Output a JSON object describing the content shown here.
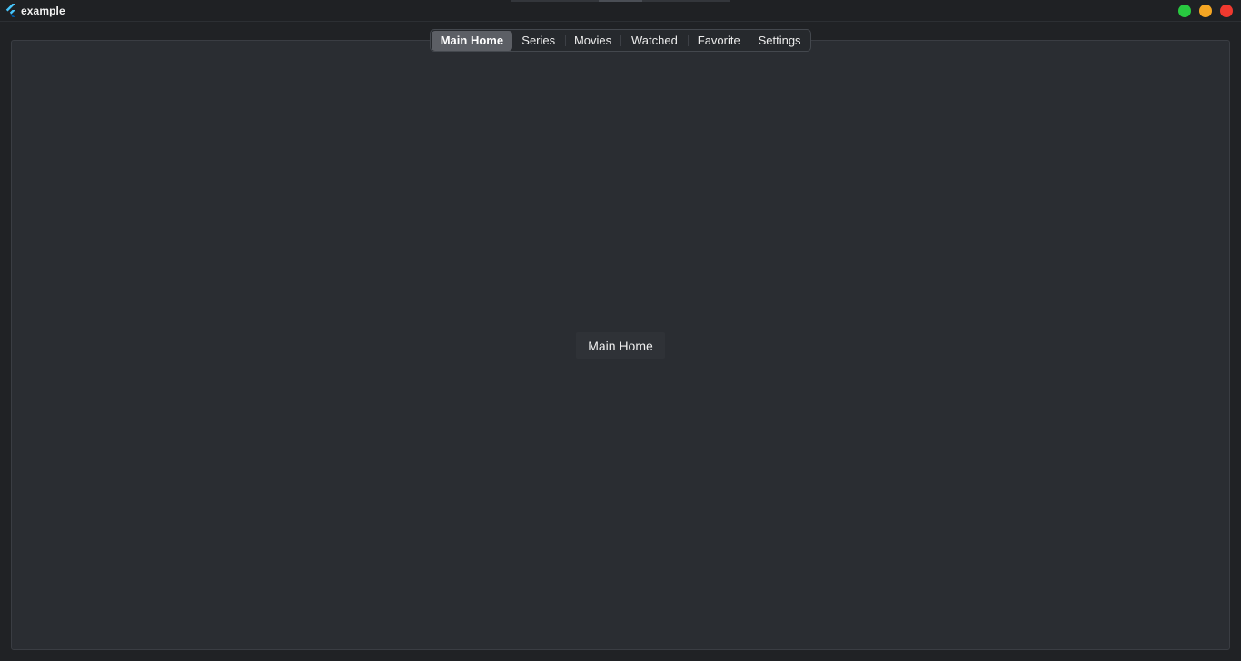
{
  "window": {
    "title": "example",
    "logo_icon": "flutter-logo-icon",
    "controls": [
      {
        "name": "maximize",
        "color": "#28c940"
      },
      {
        "name": "minimize",
        "color": "#f5a623"
      },
      {
        "name": "close",
        "color": "#f0392f"
      }
    ]
  },
  "tabs": [
    {
      "label": "Main Home",
      "active": true
    },
    {
      "label": "Series",
      "active": false
    },
    {
      "label": "Movies",
      "active": false
    },
    {
      "label": "Watched",
      "active": false
    },
    {
      "label": "Favorite",
      "active": false
    },
    {
      "label": "Settings",
      "active": false
    }
  ],
  "content": {
    "label": "Main Home"
  },
  "colors": {
    "background": "#202225",
    "panel": "#2a2d32",
    "active_tab": "#5c5f65"
  }
}
